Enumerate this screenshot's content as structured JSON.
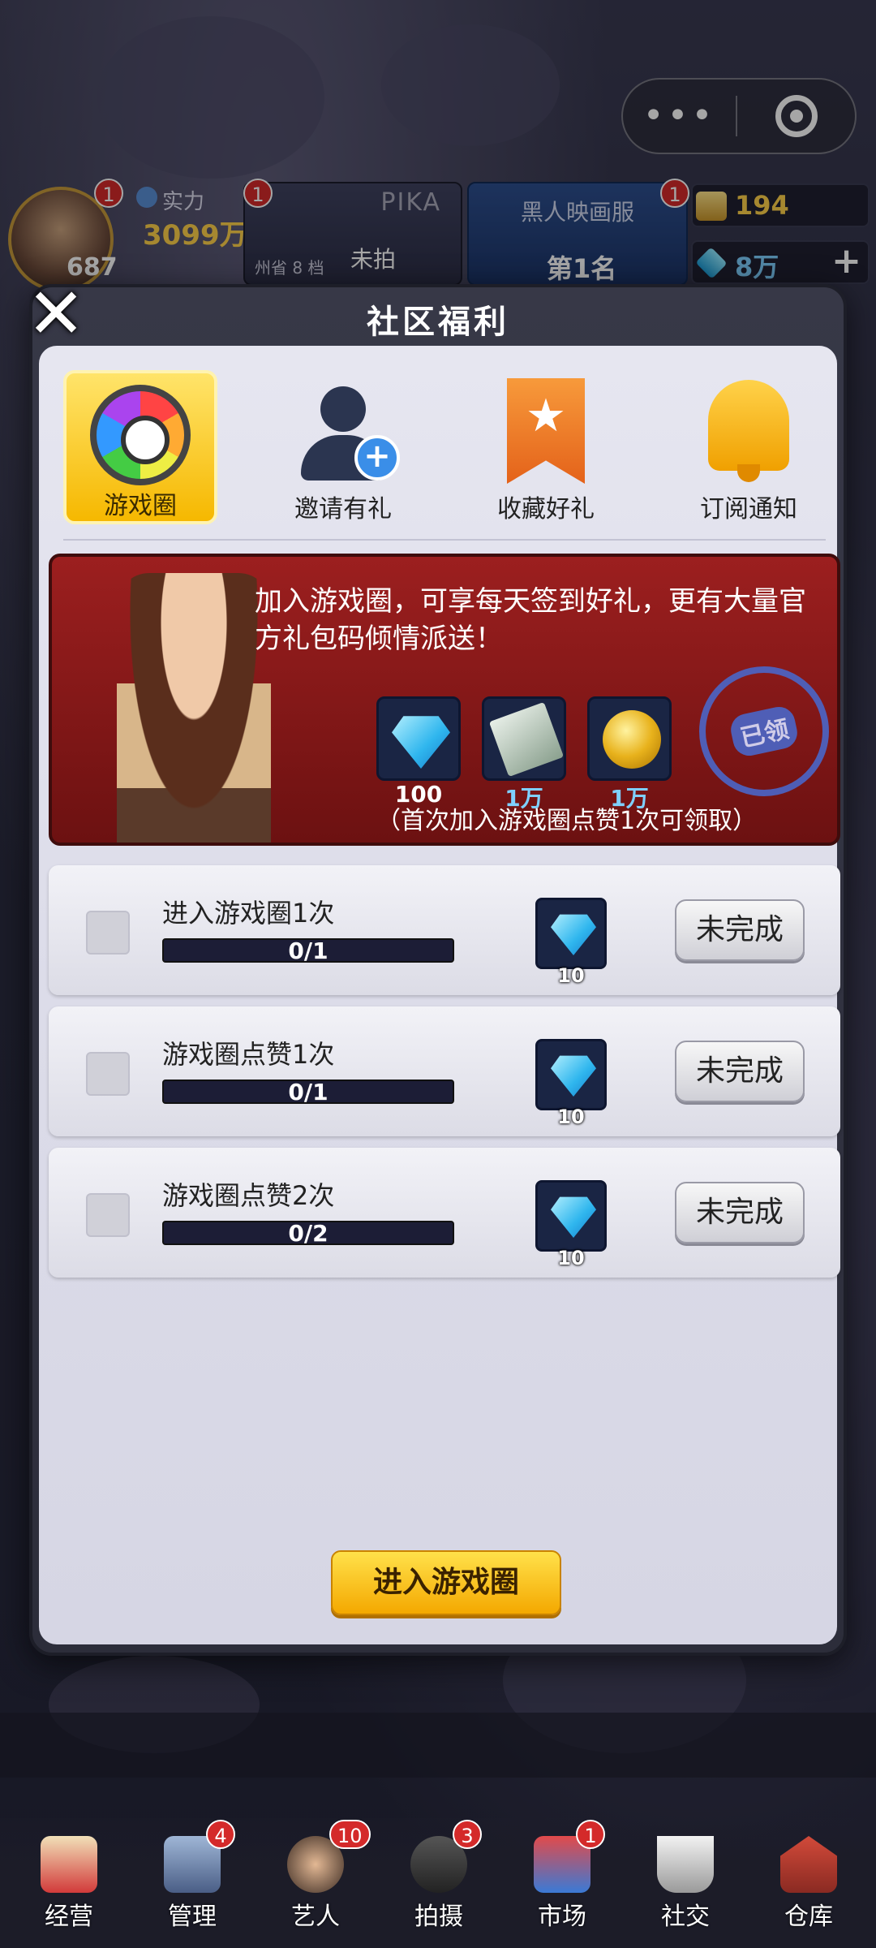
{
  "header": {
    "power_label": "实力",
    "power_value": "3099万",
    "level": "687",
    "avatar_badge": "1",
    "pika_name": "PIKA",
    "pika_status": "未拍",
    "pika_rank": "州省 8 档",
    "pika_badge": "1",
    "film_name": "黑人映画服",
    "film_rank": "第1名",
    "film_badge": "1",
    "gold": "194",
    "gems": "8万",
    "plus": "+"
  },
  "capsule": {
    "more": "•••"
  },
  "modal": {
    "title": "社区福利",
    "close": "✕",
    "tabs": [
      {
        "label": "游戏圈",
        "icon": "aperture-icon",
        "active": true
      },
      {
        "label": "邀请有礼",
        "icon": "add-user-icon",
        "active": false
      },
      {
        "label": "收藏好礼",
        "icon": "bookmark-star-icon",
        "active": false
      },
      {
        "label": "订阅通知",
        "icon": "bell-icon",
        "active": false
      }
    ],
    "banner": {
      "text": "加入游戏圈，可享每天签到好礼，更有大量官方礼包码倾情派送！",
      "rewards": [
        {
          "icon": "gem-icon",
          "value": "100",
          "color": "#ffffff"
        },
        {
          "icon": "cash-icon",
          "value": "1万",
          "color": "#7fd0ff"
        },
        {
          "icon": "coin-icon",
          "value": "1万",
          "color": "#7fd0ff"
        }
      ],
      "stamp": "已领",
      "note": "（首次加入游戏圈点赞1次可领取）"
    },
    "tasks": [
      {
        "name": "进入游戏圈1次",
        "progress_text": "0/1",
        "progress": 0,
        "reward": "10",
        "status": "未完成"
      },
      {
        "name": "游戏圈点赞1次",
        "progress_text": "0/1",
        "progress": 0,
        "reward": "10",
        "status": "未完成"
      },
      {
        "name": "游戏圈点赞2次",
        "progress_text": "0/2",
        "progress": 0,
        "reward": "10",
        "status": "未完成"
      }
    ],
    "enter_button": "进入游戏圈"
  },
  "bottom_nav": [
    {
      "label": "经营",
      "icon": "popcorn-icon",
      "badge": ""
    },
    {
      "label": "管理",
      "icon": "manage-icon",
      "badge": "4"
    },
    {
      "label": "艺人",
      "icon": "artist-icon",
      "badge": "10"
    },
    {
      "label": "拍摄",
      "icon": "camera-icon",
      "badge": "3"
    },
    {
      "label": "市场",
      "icon": "market-icon",
      "badge": "1"
    },
    {
      "label": "社交",
      "icon": "coffee-icon",
      "badge": ""
    },
    {
      "label": "仓库",
      "icon": "warehouse-icon",
      "badge": ""
    }
  ],
  "colors": {
    "accent_yellow": "#f6b800",
    "badge_red": "#d42a2a",
    "gem_blue": "#2fb6ee"
  }
}
